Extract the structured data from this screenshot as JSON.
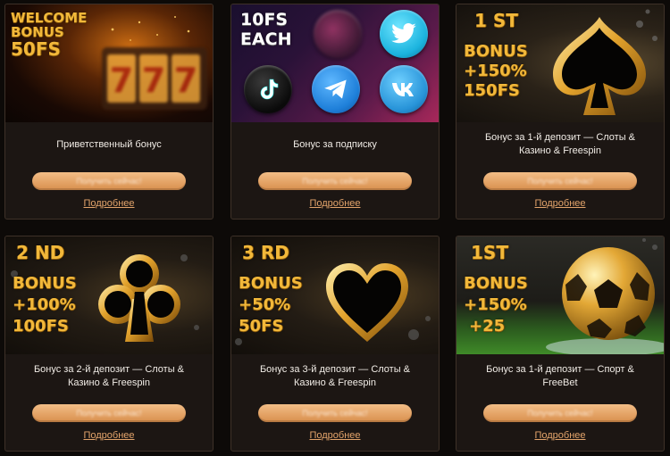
{
  "cards": [
    {
      "banner_lines": [
        "WELCOME",
        "BONUS",
        "50FS"
      ],
      "title_line1": "Приветственный бонус",
      "title_line2": "",
      "cta_label": "Получить сейчас!",
      "more_label": "Подробнее"
    },
    {
      "banner_lines": [
        "10FS",
        "EACH"
      ],
      "title_line1": "Бонус за подписку",
      "title_line2": "",
      "cta_label": "Получить сейчас!",
      "more_label": "Подробнее",
      "social_icons": [
        "instagram-icon",
        "twitter-icon",
        "tiktok-icon",
        "telegram-icon",
        "vk-icon"
      ]
    },
    {
      "banner_lines": [
        "1 ST",
        "BONUS",
        "+150%",
        "150FS"
      ],
      "title_line1": "Бонус за 1-й депозит — Слоты &",
      "title_line2": "Казино & Freespin",
      "cta_label": "Получить сейчас!",
      "more_label": "Подробнее"
    },
    {
      "banner_lines": [
        "2 ND",
        "BONUS",
        "+100%",
        "100FS"
      ],
      "title_line1": "Бонус за 2-й депозит — Слоты &",
      "title_line2": "Казино & Freespin",
      "cta_label": "Получить сейчас!",
      "more_label": "Подробнее"
    },
    {
      "banner_lines": [
        "3 RD",
        "BONUS",
        "+50%",
        "50FS"
      ],
      "title_line1": "Бонус за 3-й депозит — Слоты &",
      "title_line2": "Казино & Freespin",
      "cta_label": "Получить сейчас!",
      "more_label": "Подробнее"
    },
    {
      "banner_lines": [
        "1ST",
        "BONUS",
        "+150%",
        "+25"
      ],
      "title_line1": "Бонус за 1-й депозит — Спорт &",
      "title_line2": "FreeBet",
      "cta_label": "Получить сейчас!",
      "more_label": "Подробнее"
    }
  ],
  "colors": {
    "card_bg": "#1c1613",
    "card_border": "#3e3128",
    "gold": "#f2b83a",
    "button": "#e6a263",
    "link": "#e3a46b"
  }
}
